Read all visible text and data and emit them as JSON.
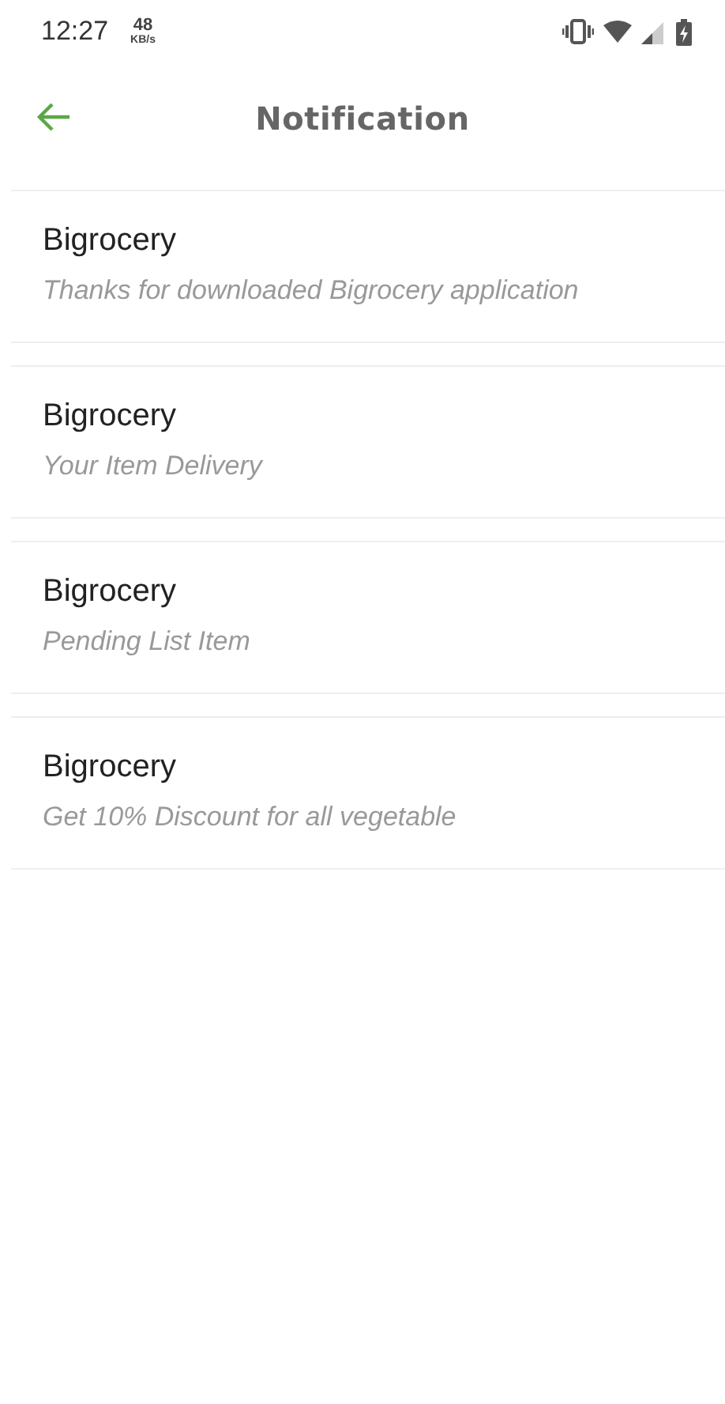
{
  "status_bar": {
    "time": "12:27",
    "speed_value": "48",
    "speed_unit": "KB/s"
  },
  "header": {
    "title": "Notification"
  },
  "notifications": [
    {
      "title": "Bigrocery",
      "message": "Thanks for downloaded Bigrocery application"
    },
    {
      "title": "Bigrocery",
      "message": "Your Item Delivery"
    },
    {
      "title": "Bigrocery",
      "message": "Pending List Item"
    },
    {
      "title": "Bigrocery",
      "message": "Get 10% Discount for all vegetable"
    }
  ]
}
